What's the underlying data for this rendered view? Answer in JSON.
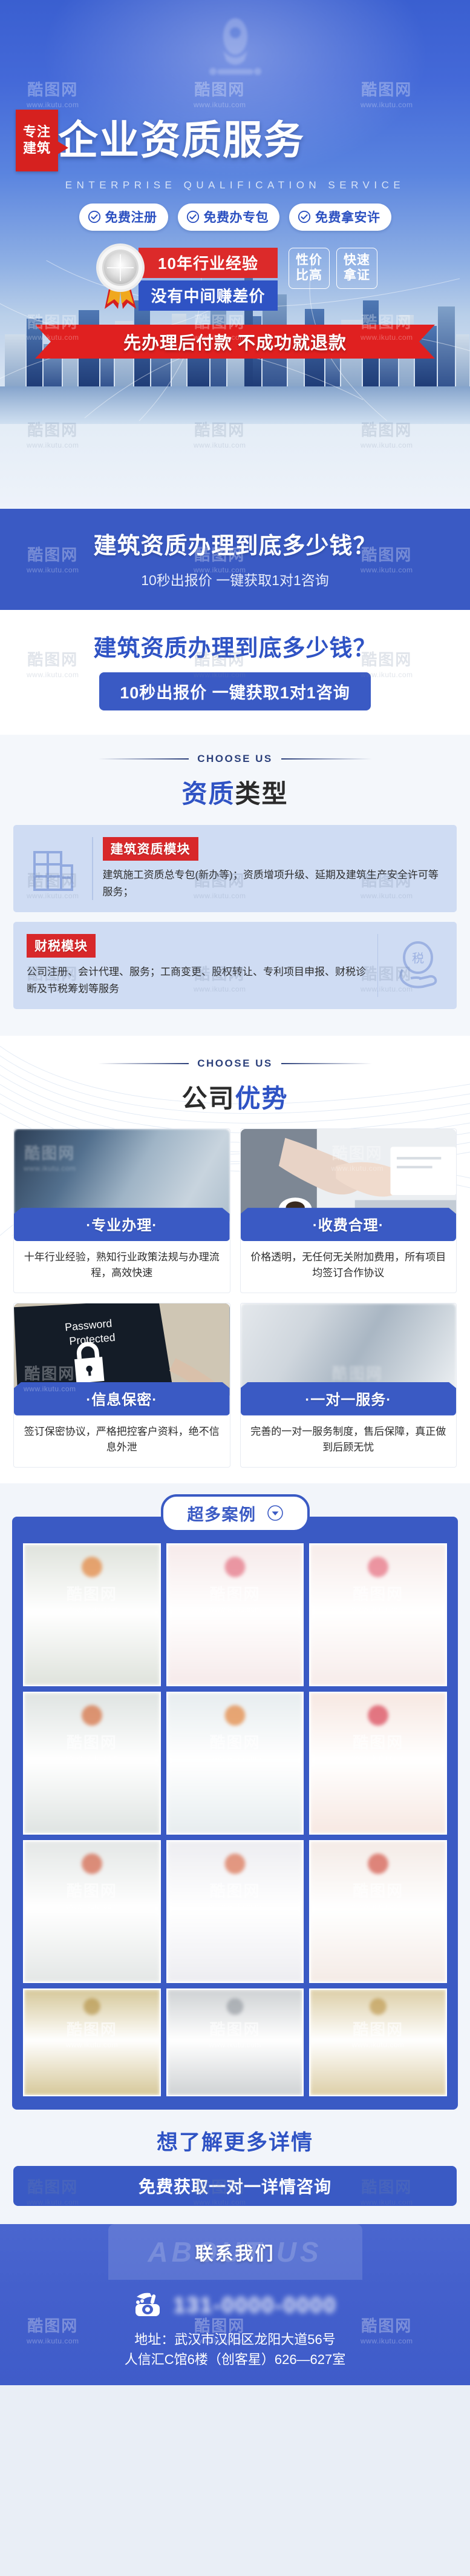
{
  "hero": {
    "corner_badge_line1": "专注",
    "corner_badge_line2": "建筑",
    "title": "企业资质服务",
    "subtitle": "ENTERPRISE QUALIFICATION SERVICE",
    "pills": [
      {
        "label": "免费注册",
        "icon": "check-circle-icon"
      },
      {
        "label": "免费办专包",
        "icon": "check-circle-icon"
      },
      {
        "label": "免费拿安许",
        "icon": "check-circle-icon"
      }
    ],
    "experience_red": "10年行业经验",
    "experience_blue": "没有中间赚差价",
    "side_badges": [
      {
        "line1": "性价",
        "line2": "比高"
      },
      {
        "line1": "快速",
        "line2": "拿证"
      }
    ],
    "ribbon": "先办理后付款 不成功就退款"
  },
  "cta_blue": {
    "question": "建筑资质办理到底多少钱？",
    "subtext": "10秒出报价 一键获取1对1咨询"
  },
  "cta_white": {
    "question": "建筑资质办理到底多少钱？",
    "button": "10秒出报价 一键获取1对1咨询"
  },
  "types_section": {
    "eyebrow": "CHOOSE US",
    "title_highlight": "资质",
    "title_rest": "类型",
    "cards": [
      {
        "tag": "建筑资质模块",
        "desc": "建筑施工资质总专包(新办等)；资质增项升级、延期及建筑生产安全许可等服务；",
        "icon": "building-grid-icon",
        "icon_side": "left"
      },
      {
        "tag": "财税模块",
        "desc": "公司注册、会计代理、服务；工商变更、股权转让、专利项目申报、财税诊断及节税筹划等服务",
        "icon": "tax-hand-icon",
        "icon_side": "right"
      }
    ]
  },
  "advantages_section": {
    "eyebrow": "CHOOSE US",
    "title_highlight": "优势",
    "title_rest": "公司",
    "cards": [
      {
        "label": "·专业办理·",
        "desc": "十年行业经验，熟知行业政策法规与办理流程，高效快速",
        "photo": "office-blur-photo"
      },
      {
        "label": "·收费合理·",
        "desc": "价格透明，无任何无关附加费用，所有项目均签订合作协议",
        "photo": "handshake-photo"
      },
      {
        "label": "·信息保密·",
        "desc": "签订保密协议，严格把控客户资料，绝不信息外泄",
        "photo": "password-protected-laptop-photo"
      },
      {
        "label": "·一对一服务·",
        "desc": "完善的一对一服务制度，售后保障，真正做到后顾无忧",
        "photo": "consultation-people-photo"
      }
    ]
  },
  "cases_section": {
    "title": "超多案例",
    "expand_icon": "chevron-down-icon",
    "items": [
      {
        "name": "certificate-1",
        "tint": "#dfe3dc",
        "seal": "#e2711d"
      },
      {
        "name": "certificate-2",
        "tint": "#f6eaea",
        "seal": "#e05a6e"
      },
      {
        "name": "certificate-3",
        "tint": "#f7ecea",
        "seal": "#e2566b"
      },
      {
        "name": "certificate-4",
        "tint": "#dfe4e2",
        "seal": "#d2571f"
      },
      {
        "name": "certificate-5",
        "tint": "#e7edef",
        "seal": "#e1711d"
      },
      {
        "name": "certificate-6",
        "tint": "#f7e8e2",
        "seal": "#d3243a"
      },
      {
        "name": "certificate-7",
        "tint": "#e4e7e6",
        "seal": "#cf4a2a"
      },
      {
        "name": "certificate-8",
        "tint": "#ededf1",
        "seal": "#d65a33"
      },
      {
        "name": "certificate-9",
        "tint": "#f4ebe6",
        "seal": "#cc3b2c"
      },
      {
        "name": "certificate-10",
        "tint": "#d6c89a",
        "seal": "#b08b3a"
      },
      {
        "name": "certificate-11",
        "tint": "#cfd2d4",
        "seal": "#8d939a"
      },
      {
        "name": "certificate-12",
        "tint": "#ddcfa8",
        "seal": "#b9903f"
      }
    ]
  },
  "bottom_cta": {
    "title": "想了解更多详情",
    "button": "免费获取一对一详情咨询"
  },
  "footer": {
    "tab_ghost": "ABOUT US",
    "tab_label": "联系我们",
    "phone_icon": "telephone-icon",
    "phone": "131-0000-0000",
    "address_line1": "地址：武汉市汉阳区龙阳大道56号",
    "address_line2": "人信汇C馆6楼（创客星）626—627室"
  },
  "watermark": {
    "brand": "酷图网",
    "url": "www.ikutu.com"
  },
  "colors": {
    "brand_blue": "#3a5ac4",
    "deep_blue": "#2f53c4",
    "accent_red": "#d8282a",
    "ribbon_red": "#e02020",
    "card_blue": "#cfdcf3"
  }
}
